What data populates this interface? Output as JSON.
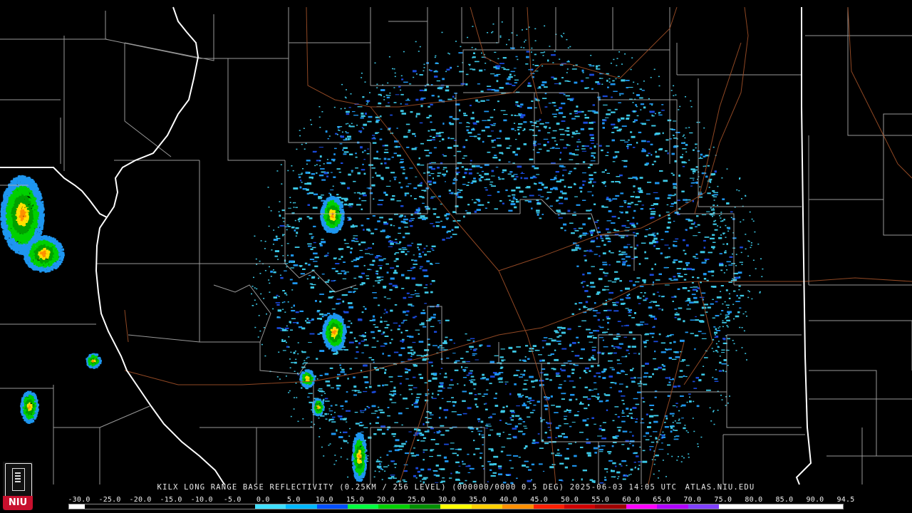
{
  "header": {
    "product_text": "KILX LONG RANGE BASE REFLECTIVITY (0.25KM / 256 LEVEL) (000000/0000 0.5 DEG) 2025-06-03 14:05 UTC",
    "site_text": "ATLAS.NIU.EDU"
  },
  "logo": {
    "text": "NIU"
  },
  "legend": {
    "ticks": [
      "-30.0",
      "-25.0",
      "-20.0",
      "-15.0",
      "-10.0",
      "-5.0",
      "0.0",
      "5.0",
      "10.0",
      "15.0",
      "20.0",
      "25.0",
      "30.0",
      "35.0",
      "40.0",
      "45.0",
      "50.0",
      "55.0",
      "60.0",
      "65.0",
      "70.0",
      "75.0",
      "80.0",
      "85.0",
      "90.0",
      "94.5"
    ],
    "colors": [
      "#000000",
      "#000000",
      "#000000",
      "#000000",
      "#000000",
      "#000000",
      "#00c8ff",
      "#0090ff",
      "#0020ff",
      "#00ff00",
      "#00d000",
      "#00a000",
      "#ffff00",
      "#ffc000",
      "#ff8000",
      "#ff0000",
      "#d00000",
      "#b00000",
      "#ff00ff",
      "#a000ff",
      "#ffffff",
      "#ffffff"
    ]
  },
  "map": {
    "radar_site": "KILX",
    "background_color": "#000000",
    "county_line_color": "#b4b4b4",
    "state_line_color": "#ffffff",
    "road_color": "#a05028"
  }
}
